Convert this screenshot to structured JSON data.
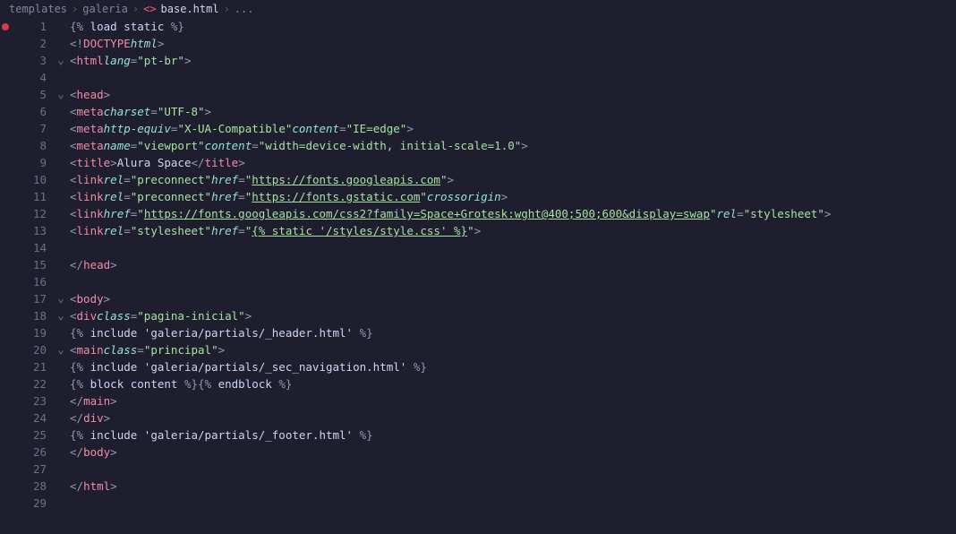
{
  "breadcrumb": {
    "parts": [
      "templates",
      "galeria",
      "base.html"
    ],
    "file_icon": "<>",
    "ellipsis": "..."
  },
  "fold_markers": {
    "3": "v",
    "5": "v",
    "17": "v",
    "18": "v",
    "20": "v"
  },
  "breakpoint_line": 1,
  "lines": [
    {
      "n": 1,
      "html": "<span class='punct'>{%</span><span class='django'> load static </span><span class='punct'>%}</span>"
    },
    {
      "n": 2,
      "html": "<span class='punct'>&lt;!</span><span class='kw'>DOCTYPE</span> <span class='attr'>html</span><span class='punct'>&gt;</span>"
    },
    {
      "n": 3,
      "html": "<span class='punct'>&lt;</span><span class='tag'>html</span> <span class='attr'>lang</span><span class='punct'>=</span><span class='str'>\"pt-br\"</span><span class='punct'>&gt;</span>"
    },
    {
      "n": 4,
      "html": ""
    },
    {
      "n": 5,
      "html": "<span class='punct'>&lt;</span><span class='tag'>head</span><span class='punct'>&gt;</span>"
    },
    {
      "n": 6,
      "html": "    <span class='punct'>&lt;</span><span class='tag'>meta</span> <span class='attr'>charset</span><span class='punct'>=</span><span class='str'>\"UTF-8\"</span><span class='punct'>&gt;</span>"
    },
    {
      "n": 7,
      "html": "    <span class='punct'>&lt;</span><span class='tag'>meta</span> <span class='attr'>http-equiv</span><span class='punct'>=</span><span class='str'>\"X-UA-Compatible\"</span> <span class='attr'>content</span><span class='punct'>=</span><span class='str'>\"IE=edge\"</span><span class='punct'>&gt;</span>"
    },
    {
      "n": 8,
      "html": "    <span class='punct'>&lt;</span><span class='tag'>meta</span> <span class='attr'>name</span><span class='punct'>=</span><span class='str'>\"viewport\"</span> <span class='attr'>content</span><span class='punct'>=</span><span class='str'>\"width=device-width, initial-scale=1.0\"</span><span class='punct'>&gt;</span>"
    },
    {
      "n": 9,
      "html": "    <span class='punct'>&lt;</span><span class='tag'>title</span><span class='punct'>&gt;</span><span class='text'>Alura Space</span><span class='punct'>&lt;/</span><span class='tag'>title</span><span class='punct'>&gt;</span>"
    },
    {
      "n": 10,
      "html": "    <span class='punct'>&lt;</span><span class='tag'>link</span> <span class='attr'>rel</span><span class='punct'>=</span><span class='str'>\"preconnect\"</span> <span class='attr'>href</span><span class='punct'>=</span><span class='str'>\"</span><span class='str-u'>https://fonts.googleapis.com</span><span class='str'>\"</span><span class='punct'>&gt;</span>"
    },
    {
      "n": 11,
      "html": "    <span class='punct'>&lt;</span><span class='tag'>link</span> <span class='attr'>rel</span><span class='punct'>=</span><span class='str'>\"preconnect\"</span> <span class='attr'>href</span><span class='punct'>=</span><span class='str'>\"</span><span class='str-u'>https://fonts.gstatic.com</span><span class='str'>\"</span> <span class='attr'>crossorigin</span><span class='punct'>&gt;</span>"
    },
    {
      "n": 12,
      "html": "    <span class='punct'>&lt;</span><span class='tag'>link</span> <span class='attr'>href</span><span class='punct'>=</span><span class='str'>\"</span><span class='str-u'>https://fonts.googleapis.com/css2?family=Space+Grotesk:wght@400;500;600&amp;display=swap</span><span class='str'>\"</span> <span class='attr'>rel</span><span class='punct'>=</span><span class='str'>\"stylesheet\"</span><span class='punct'>&gt;</span>"
    },
    {
      "n": 13,
      "html": "    <span class='punct'>&lt;</span><span class='tag'>link</span> <span class='attr'>rel</span><span class='punct'>=</span><span class='str'>\"stylesheet\"</span> <span class='attr'>href</span><span class='punct'>=</span><span class='str'>\"</span><span class='str-u'>{% static '/styles/style.css' %}</span><span class='str'>\"</span><span class='punct'>&gt;</span>"
    },
    {
      "n": 14,
      "html": ""
    },
    {
      "n": 15,
      "html": "<span class='punct'>&lt;/</span><span class='tag'>head</span><span class='punct'>&gt;</span>"
    },
    {
      "n": 16,
      "html": ""
    },
    {
      "n": 17,
      "html": "<span class='punct'>&lt;</span><span class='tag'>body</span><span class='punct'>&gt;</span>"
    },
    {
      "n": 18,
      "html": "    <span class='punct'>&lt;</span><span class='tag'>div</span> <span class='attr'>class</span><span class='punct'>=</span><span class='str'>\"pagina-inicial\"</span><span class='punct'>&gt;</span>"
    },
    {
      "n": 19,
      "html": "        <span class='punct'>{%</span><span class='django'> include 'galeria/partials/_header.html' </span><span class='punct'>%}</span>"
    },
    {
      "n": 20,
      "html": "        <span class='punct'>&lt;</span><span class='tag'>main</span> <span class='attr'>class</span><span class='punct'>=</span><span class='str'>\"principal\"</span><span class='punct'>&gt;</span>"
    },
    {
      "n": 21,
      "html": "            <span class='punct'>{%</span><span class='django'> include 'galeria/partials/_sec_navigation.html' </span><span class='punct'>%}</span>"
    },
    {
      "n": 22,
      "html": "            <span class='punct'>{%</span><span class='django'> block content </span><span class='punct'>%}{%</span><span class='django'> endblock </span><span class='punct'>%}</span>"
    },
    {
      "n": 23,
      "html": "        <span class='punct'>&lt;/</span><span class='tag'>main</span><span class='punct'>&gt;</span>"
    },
    {
      "n": 24,
      "html": "    <span class='punct'>&lt;/</span><span class='tag'>div</span><span class='punct'>&gt;</span>"
    },
    {
      "n": 25,
      "html": "    <span class='punct'>{%</span><span class='django'> include 'galeria/partials/_footer.html' </span><span class='punct'>%}</span>"
    },
    {
      "n": 26,
      "html": "<span class='punct'>&lt;/</span><span class='tag'>body</span><span class='punct'>&gt;</span>"
    },
    {
      "n": 27,
      "html": ""
    },
    {
      "n": 28,
      "html": "<span class='punct'>&lt;/</span><span class='tag'>html</span><span class='punct'>&gt;</span>"
    },
    {
      "n": 29,
      "html": ""
    }
  ]
}
